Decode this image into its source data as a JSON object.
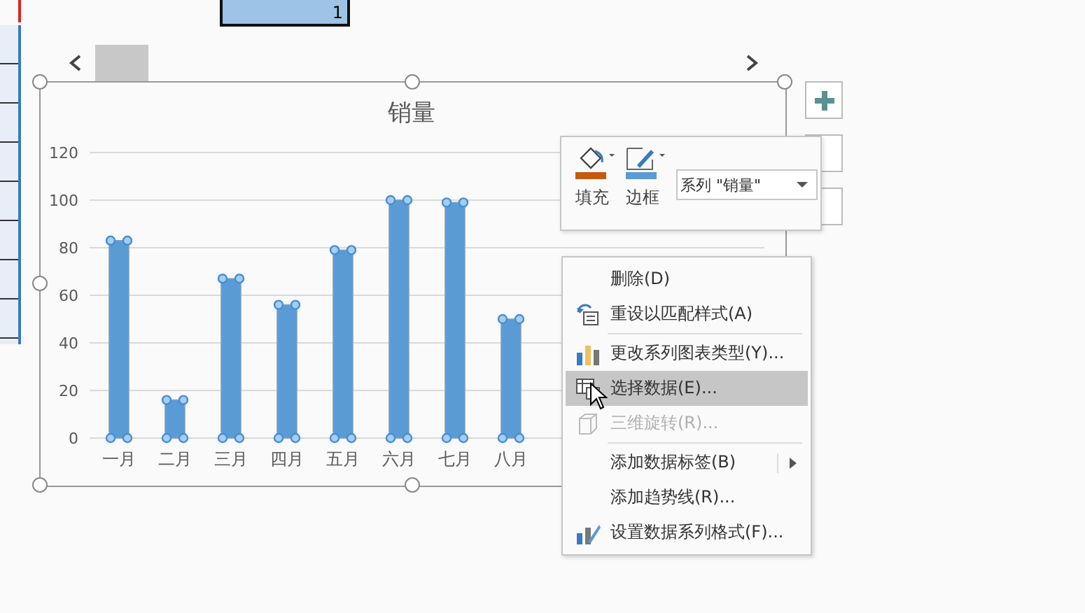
{
  "cell": {
    "value": "1"
  },
  "chart": {
    "chart_data": {
      "type": "bar",
      "title": "销量",
      "categories": [
        "一月",
        "二月",
        "三月",
        "四月",
        "五月",
        "六月",
        "七月",
        "八月"
      ],
      "series": [
        {
          "color": "#5b9bd5",
          "values": [
            83,
            16,
            67,
            56,
            79,
            100,
            99,
            50
          ]
        }
      ],
      "grid": true,
      "ylim": [
        0,
        120
      ],
      "yticks": [
        0,
        20,
        40,
        60,
        80,
        100,
        120
      ]
    }
  },
  "mini_toolbar": {
    "fill_label": "填充",
    "border_label": "边框",
    "series_select": "系列 \"销量\""
  },
  "context_menu": [
    {
      "label": "删除(D)",
      "kind": "plain",
      "disabled": false,
      "selected": false,
      "separator_before": false,
      "submenu": false
    },
    {
      "label": "重设以匹配样式(A)",
      "kind": "reset",
      "disabled": false,
      "selected": false,
      "separator_before": false,
      "submenu": false
    },
    {
      "label": "更改系列图表类型(Y)...",
      "kind": "chart-type",
      "disabled": false,
      "selected": false,
      "separator_before": true,
      "submenu": false
    },
    {
      "label": "选择数据(E)...",
      "kind": "data",
      "disabled": false,
      "selected": true,
      "separator_before": false,
      "submenu": false
    },
    {
      "label": "三维旋转(R)...",
      "kind": "rotate",
      "disabled": true,
      "selected": false,
      "separator_before": false,
      "submenu": false
    },
    {
      "label": "添加数据标签(B)",
      "kind": "plain",
      "disabled": false,
      "selected": false,
      "separator_before": true,
      "submenu": true
    },
    {
      "label": "添加趋势线(R)...",
      "kind": "plain",
      "disabled": false,
      "selected": false,
      "separator_before": false,
      "submenu": false
    },
    {
      "label": "设置数据系列格式(F)...",
      "kind": "format",
      "disabled": false,
      "selected": false,
      "separator_before": false,
      "submenu": false
    }
  ]
}
